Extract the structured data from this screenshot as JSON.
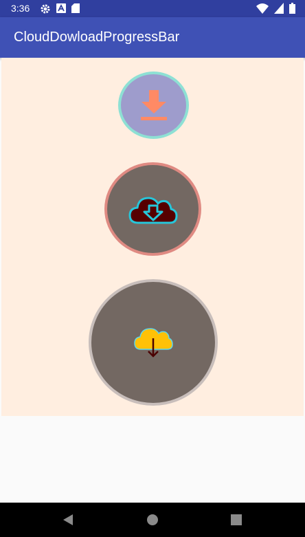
{
  "status_bar": {
    "time": "3:36",
    "icons_left": [
      "gear-icon",
      "font-a-icon",
      "sd-card-icon"
    ],
    "icons_right": [
      "wifi-icon",
      "signal-icon",
      "battery-icon"
    ]
  },
  "app_bar": {
    "title": "CloudDowloadProgressBar"
  },
  "buttons": [
    {
      "name": "download-button-small",
      "icon": "download-arrow-icon",
      "accent": "#ff8a65",
      "fill": "#9e9ccc",
      "ring": "#8ee0d4"
    },
    {
      "name": "cloud-download-button-medium",
      "icon": "cloud-download-icon",
      "accent": "#26c6da",
      "fill": "#736862",
      "ring": "#df8a82"
    },
    {
      "name": "cloud-download-button-large",
      "icon": "cloud-download-icon",
      "accent": "#ffc107",
      "fill": "#736862",
      "ring": "#c8bebb"
    }
  ],
  "nav_bar": {
    "buttons": [
      "back-icon",
      "home-icon",
      "recents-icon"
    ]
  },
  "colors": {
    "primary": "#3f51b5",
    "primary_dark": "#303f9f",
    "content_bg": "#ffeee0"
  }
}
